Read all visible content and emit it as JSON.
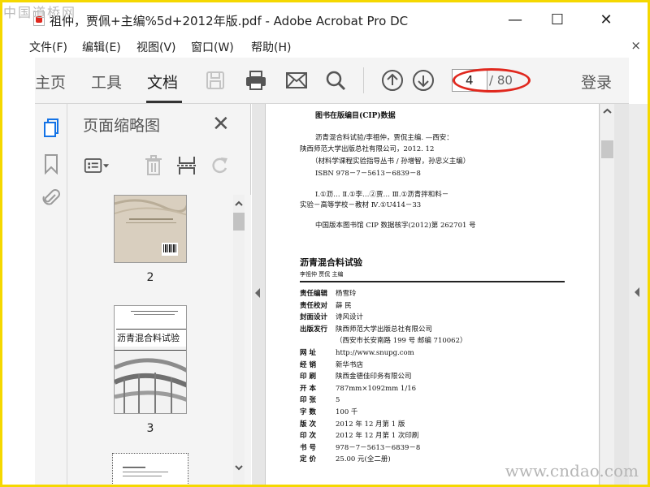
{
  "window": {
    "title": "祖仲，贾佩+主编%5d+2012年版.pdf - Adobe Acrobat Pro DC",
    "minimize": "—",
    "maximize": "☐",
    "close": "✕"
  },
  "watermarks": {
    "top_left": "中国道桥网",
    "bottom_right": "www.cndao.com"
  },
  "menu": {
    "items": [
      "文件(F)",
      "编辑(E)",
      "视图(V)",
      "窗口(W)",
      "帮助(H)"
    ],
    "close": "×"
  },
  "toolbar": {
    "tabs": [
      "主页",
      "工具",
      "文档"
    ],
    "active_tab": "文档",
    "icons": [
      "save-icon",
      "print-icon",
      "email-icon",
      "search-icon",
      "page-up-icon",
      "page-down-icon"
    ],
    "page_current": "4",
    "page_total": "/ 80",
    "login": "登录"
  },
  "left_rail": {
    "icons": [
      "page-thumbnails-icon",
      "bookmark-icon",
      "attachment-icon"
    ]
  },
  "thumbnails_panel": {
    "title": "页面缩略图",
    "close": "✕",
    "tools": [
      "page-options-icon",
      "delete-icon",
      "crop-icon",
      "rotate-icon"
    ],
    "pages": [
      {
        "label": "2"
      },
      {
        "label": "3",
        "cover_title": "沥青混合料试验"
      },
      {
        "label": ""
      }
    ]
  },
  "document": {
    "cip_title": "图书在版编目(CIP)数据",
    "cip_lines": [
      "沥青混合料试验/李祖仲，贾侃主编. —西安：",
      "陕西师范大学出版总社有限公司，2012. 12",
      "（材料学课程实验指导丛书 / 孙增智，孙忠义主编）",
      "ISBN 978－7－5613－6839－8",
      "Ⅰ.①沥…  Ⅱ.①李…②贾…  Ⅲ.①沥青拌和料－",
      "实验－高等学校－教材 Ⅳ.①U414－33",
      "中国版本图书馆 CIP 数据核字(2012)第 262701 号"
    ],
    "book_title": "沥青混合料试验",
    "authors_line": "李祖仲    贾侃    主编",
    "details": [
      {
        "label": "责任编辑",
        "value": "杨雪玲"
      },
      {
        "label": "责任校对",
        "value": "薛    民"
      },
      {
        "label": "封面设计",
        "value": "诗风设计"
      },
      {
        "label": "出版发行",
        "value": "陕西师范大学出版总社有限公司"
      },
      {
        "label": "",
        "value": "（西安市长安南路 199 号    邮编  710062）"
      },
      {
        "label": "网    址",
        "value": "http://www.snupg.com"
      },
      {
        "label": "经    销",
        "value": "新华书店"
      },
      {
        "label": "印    刷",
        "value": "陕西金德佳印务有限公司"
      },
      {
        "label": "开    本",
        "value": "787mm×1092mm 1/16"
      },
      {
        "label": "印    张",
        "value": "5"
      },
      {
        "label": "字    数",
        "value": "100 千"
      },
      {
        "label": "版    次",
        "value": "2012 年 12 月第 1 版"
      },
      {
        "label": "印    次",
        "value": "2012 年 12 月第 1 次印刷"
      },
      {
        "label": "书    号",
        "value": "978－7－5613－6839－8"
      },
      {
        "label": "定    价",
        "value": "25.00 元(全二册)"
      }
    ]
  },
  "colors": {
    "accent": "#1473e6",
    "highlight": "#e0281e",
    "frame": "#f5d800"
  }
}
